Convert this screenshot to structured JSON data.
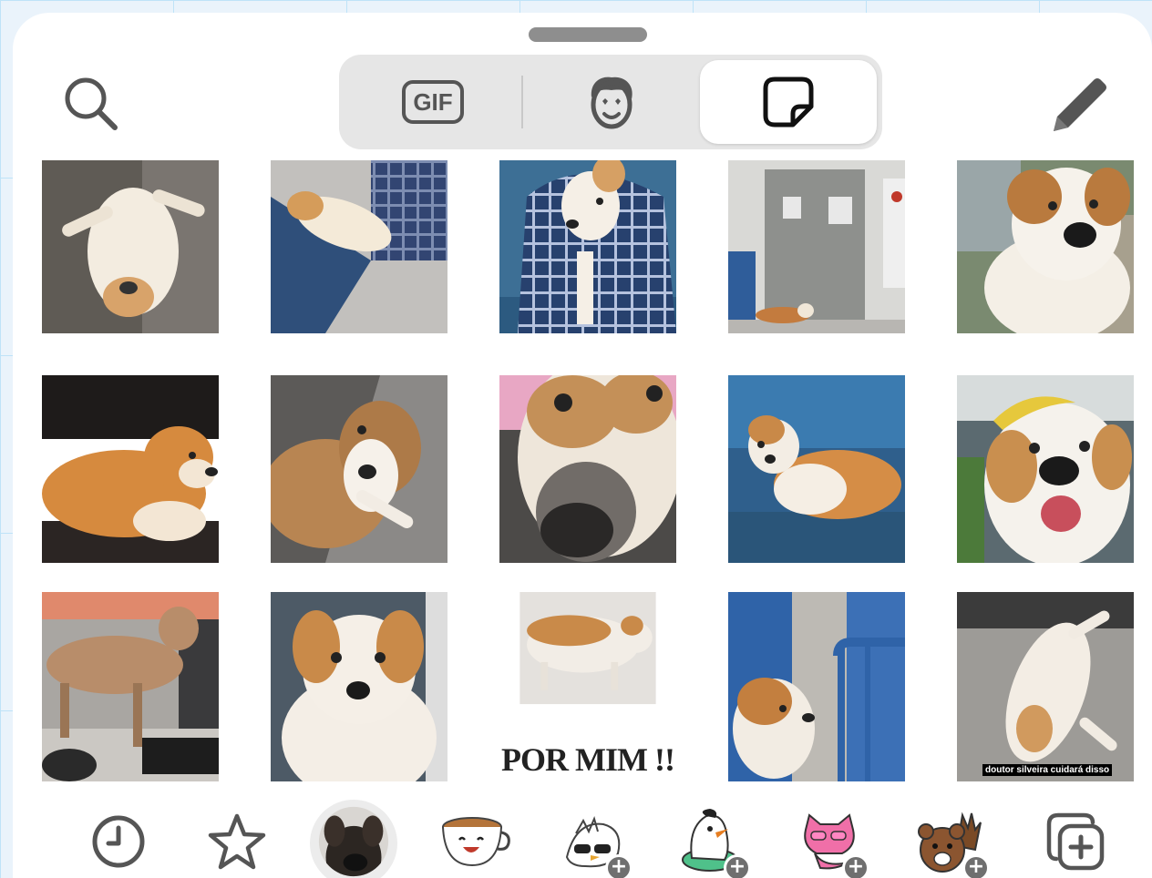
{
  "tabs": [
    {
      "name": "gif",
      "label": "GIF",
      "active": false
    },
    {
      "name": "avatar",
      "label": "",
      "active": false
    },
    {
      "name": "stickers",
      "label": "",
      "active": true
    }
  ],
  "toolbar": {
    "search_icon": "search-icon",
    "edit_icon": "pencil-icon"
  },
  "stickers": [
    {
      "id": 1,
      "caption": ""
    },
    {
      "id": 2,
      "caption": ""
    },
    {
      "id": 3,
      "caption": ""
    },
    {
      "id": 4,
      "caption": ""
    },
    {
      "id": 5,
      "caption": ""
    },
    {
      "id": 6,
      "caption": ""
    },
    {
      "id": 7,
      "caption": ""
    },
    {
      "id": 8,
      "caption": ""
    },
    {
      "id": 9,
      "caption": ""
    },
    {
      "id": 10,
      "caption": ""
    },
    {
      "id": 11,
      "caption": ""
    },
    {
      "id": 12,
      "caption": ""
    },
    {
      "id": 13,
      "caption": "POR MIM !!"
    },
    {
      "id": 14,
      "caption": ""
    },
    {
      "id": 15,
      "caption": "doutor silveira cuidará disso"
    }
  ],
  "packs": [
    {
      "name": "recent",
      "icon": "clock-icon",
      "selected": false
    },
    {
      "name": "favorites",
      "icon": "star-icon",
      "selected": false
    },
    {
      "name": "dog-pack",
      "icon": "dog-avatar-icon",
      "selected": true
    },
    {
      "name": "coffee-pack",
      "icon": "coffee-cup-icon",
      "selected": false
    },
    {
      "name": "bird-pack",
      "icon": "bird-sunglasses-icon",
      "selected": false,
      "downloadable": true
    },
    {
      "name": "penguin-pack",
      "icon": "penguin-icon",
      "selected": false,
      "downloadable": true
    },
    {
      "name": "cat-pack",
      "icon": "pink-cat-icon",
      "selected": false,
      "downloadable": true
    },
    {
      "name": "bear-pack",
      "icon": "bear-waving-icon",
      "selected": false,
      "downloadable": true
    },
    {
      "name": "add-sticker",
      "icon": "add-sticker-icon",
      "selected": false
    }
  ],
  "colors": {
    "accent_segment_bg": "#e6e6e6",
    "icon_gray": "#555555"
  }
}
